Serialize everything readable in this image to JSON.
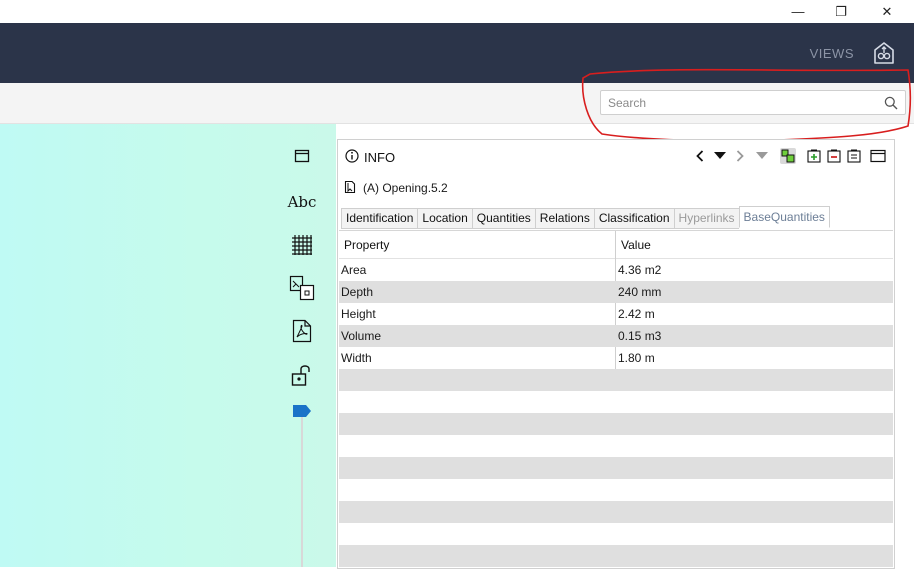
{
  "window": {
    "minimize_glyph": "—",
    "maximize_glyph": "❐",
    "close_glyph": "✕"
  },
  "header": {
    "views_label": "VIEWS",
    "views_icon": "home-views-icon"
  },
  "search": {
    "placeholder": "Search",
    "icon": "search-icon"
  },
  "tools": [
    {
      "name": "window-tool-icon"
    },
    {
      "name": "text-tool",
      "label": "Abc"
    },
    {
      "name": "grid-tool-icon"
    },
    {
      "name": "layout-tool-icon"
    },
    {
      "name": "pdf-tool-icon"
    },
    {
      "name": "unlock-tool-icon"
    }
  ],
  "slider": {
    "value": 1.0
  },
  "info_panel": {
    "title": "INFO",
    "object_name": "(A) Opening.5.2",
    "tabs": [
      {
        "label": "Identification",
        "state": "normal"
      },
      {
        "label": "Location",
        "state": "normal"
      },
      {
        "label": "Quantities",
        "state": "normal"
      },
      {
        "label": "Relations",
        "state": "normal"
      },
      {
        "label": "Classification",
        "state": "normal"
      },
      {
        "label": "Hyperlinks",
        "state": "disabled"
      },
      {
        "label": "BaseQuantities",
        "state": "active"
      }
    ],
    "columns": [
      "Property",
      "Value"
    ],
    "rows": [
      {
        "property": "Area",
        "value": "4.36 m2"
      },
      {
        "property": "Depth",
        "value": "240 mm"
      },
      {
        "property": "Height",
        "value": "2.42 m"
      },
      {
        "property": "Volume",
        "value": "0.15 m3"
      },
      {
        "property": "Width",
        "value": "1.80 m"
      }
    ],
    "empty_rows": 9
  },
  "colors": {
    "header_bg": "#2b3449",
    "canvas_bg": "#c3faf0",
    "accent_blue": "#1a73c8",
    "annotation_red": "#d81e1e"
  }
}
